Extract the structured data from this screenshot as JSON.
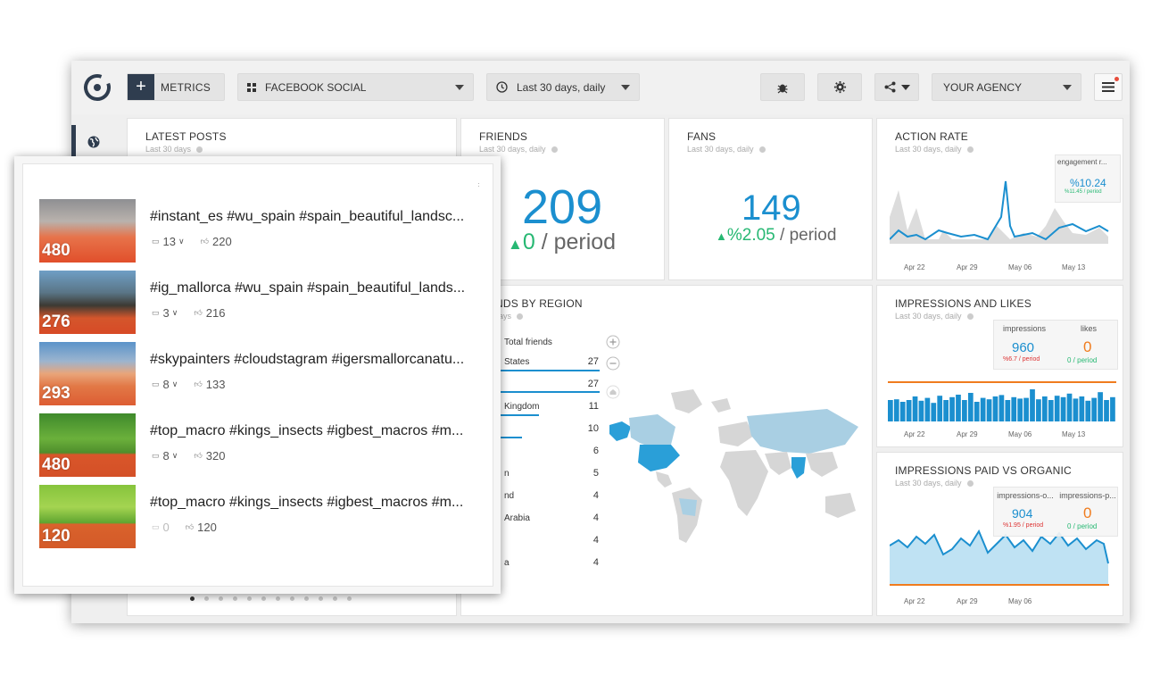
{
  "topbar": {
    "metrics_label": "METRICS",
    "source_label": "FACEBOOK SOCIAL",
    "date_label": "Last 30 days, daily",
    "agency_label": "YOUR AGENCY"
  },
  "cards": {
    "latest_posts": {
      "title": "LATEST POSTS",
      "sub": "Last 30 days"
    },
    "friends": {
      "title": "FRIENDS",
      "sub": "Last 30 days, daily",
      "value": "209",
      "delta": "0",
      "period": "/ period"
    },
    "fans": {
      "title": "FANS",
      "sub": "Last 30 days, daily",
      "value": "149",
      "delta": "%2.05",
      "period": "/ period"
    },
    "action_rate": {
      "title": "ACTION RATE",
      "sub": "Last 30 days, daily",
      "legend": "engagement r...",
      "value": "%10.24",
      "delta": "%11.45 / period",
      "x_labels": [
        "Apr 22",
        "Apr 29",
        "May 06",
        "May 13"
      ]
    },
    "region": {
      "title": "NDS BY REGION",
      "sub": "ays",
      "col_header": "Total friends",
      "rows": [
        {
          "name": "States",
          "value": "27"
        },
        {
          "name": "",
          "value": "27"
        },
        {
          "name": "Kingdom",
          "value": "11"
        },
        {
          "name": "",
          "value": "10"
        },
        {
          "name": "",
          "value": "6"
        },
        {
          "name": "n",
          "value": "5"
        },
        {
          "name": "nd",
          "value": "4"
        },
        {
          "name": "Arabia",
          "value": "4"
        },
        {
          "name": "",
          "value": "4"
        },
        {
          "name": "a",
          "value": "4"
        }
      ]
    },
    "impressions_likes": {
      "title": "IMPRESSIONS AND LIKES",
      "sub": "Last 30 days, daily",
      "h1": "impressions",
      "v1": "960",
      "d1": "%6.7 / period",
      "h2": "likes",
      "v2": "0",
      "d2": "0 / period",
      "x_labels": [
        "Apr 22",
        "Apr 29",
        "May 06",
        "May 13"
      ]
    },
    "paid_organic": {
      "title": "IMPRESSIONS PAID VS ORGANIC",
      "sub": "Last 30 days, daily",
      "h1": "impressions-o...",
      "v1": "904",
      "d1": "%1.95 / period",
      "h2": "impressions-p...",
      "v2": "0",
      "d2": "0 / period",
      "x_labels": [
        "Apr 22",
        "Apr 29",
        "May 06"
      ]
    }
  },
  "posts": [
    {
      "text": "#instant_es #wu_spain #spain_beautiful_landsc...",
      "score": "480",
      "comments": "13",
      "likes": "220"
    },
    {
      "text": "#ig_mallorca #wu_spain #spain_beautiful_lands...",
      "score": "276",
      "comments": "3",
      "likes": "216"
    },
    {
      "text": "#skypainters #cloudstagram #igersmallorcanatu...",
      "score": "293",
      "comments": "8",
      "likes": "133"
    },
    {
      "text": "#top_macro #kings_insects #igbest_macros #m...",
      "score": "480",
      "comments": "8",
      "likes": "320"
    },
    {
      "text": "#top_macro #kings_insects #igbest_macros #m...",
      "score": "120",
      "comments": "0",
      "likes": "120"
    }
  ],
  "colors": {
    "accent": "#1b8fcf",
    "positive": "#27b873",
    "orange": "#f07c1e",
    "navy": "#2f3d4f"
  }
}
